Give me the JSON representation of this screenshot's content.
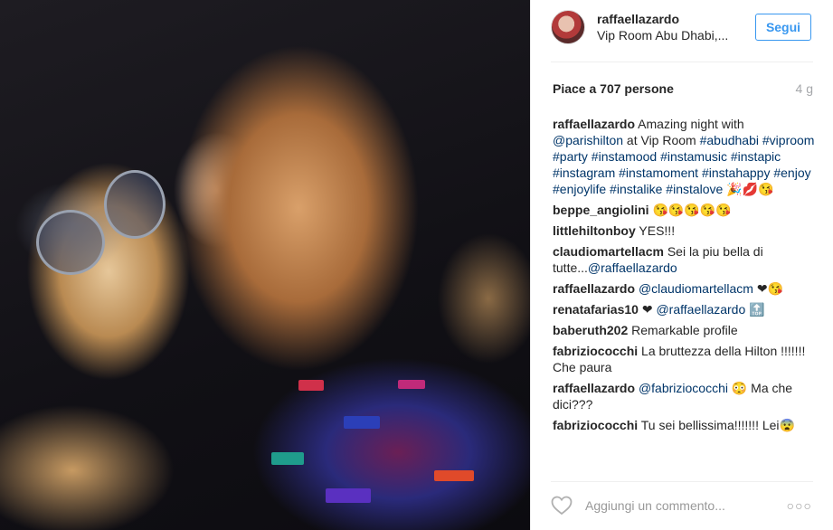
{
  "post": {
    "username": "raffaellazardo",
    "location": "Vip Room Abu Dhabi,...",
    "follow_label": "Segui",
    "likes": "Piace a 707 persone",
    "age": "4 g",
    "add_comment_placeholder": "Aggiungi un commento...",
    "more_label": "○○○"
  },
  "comments": [
    {
      "user": "raffaellazardo",
      "parts": [
        {
          "t": " Amazing night with "
        },
        {
          "t": "@parishilton",
          "link": true
        },
        {
          "t": " at Vip Room "
        },
        {
          "t": "#abudhabi #viproom #party #instamood #instamusic #instapic #instagram #instamoment #instahappy #enjoy #enjoylife #instalike #instalove",
          "link": true
        },
        {
          "t": " 🎉💋😘"
        }
      ]
    },
    {
      "user": "beppe_angiolini",
      "parts": [
        {
          "t": " 😘😘😘😘😘"
        }
      ]
    },
    {
      "user": "littlehiltonboy",
      "parts": [
        {
          "t": " YES!!!"
        }
      ]
    },
    {
      "user": "claudiomartellacm",
      "parts": [
        {
          "t": " Sei la piu bella di tutte..."
        },
        {
          "t": "@raffaellazardo",
          "link": true
        }
      ]
    },
    {
      "user": "raffaellazardo",
      "parts": [
        {
          "t": " "
        },
        {
          "t": "@claudiomartellacm",
          "link": true
        },
        {
          "t": " ❤😘"
        }
      ]
    },
    {
      "user": "renatafarias10",
      "parts": [
        {
          "t": " ❤ "
        },
        {
          "t": "@raffaellazardo",
          "link": true
        },
        {
          "t": " 🔝"
        }
      ]
    },
    {
      "user": "baberuth202",
      "parts": [
        {
          "t": " Remarkable profile"
        }
      ]
    },
    {
      "user": "fabriziococchi",
      "parts": [
        {
          "t": " La bruttezza della Hilton !!!!!!! Che paura"
        }
      ]
    },
    {
      "user": "raffaellazardo",
      "parts": [
        {
          "t": " "
        },
        {
          "t": "@fabriziococchi",
          "link": true
        },
        {
          "t": " 😳 Ma che dici???"
        }
      ]
    },
    {
      "user": "fabriziococchi",
      "parts": [
        {
          "t": " Tu sei bellissima!!!!!!! Lei😨"
        }
      ]
    }
  ],
  "colors": {
    "link": "#003569",
    "follow": "#3897f0",
    "muted": "#a5a7aa"
  },
  "icons": {
    "heart": "heart-outline-icon",
    "more": "ellipsis-icon"
  }
}
